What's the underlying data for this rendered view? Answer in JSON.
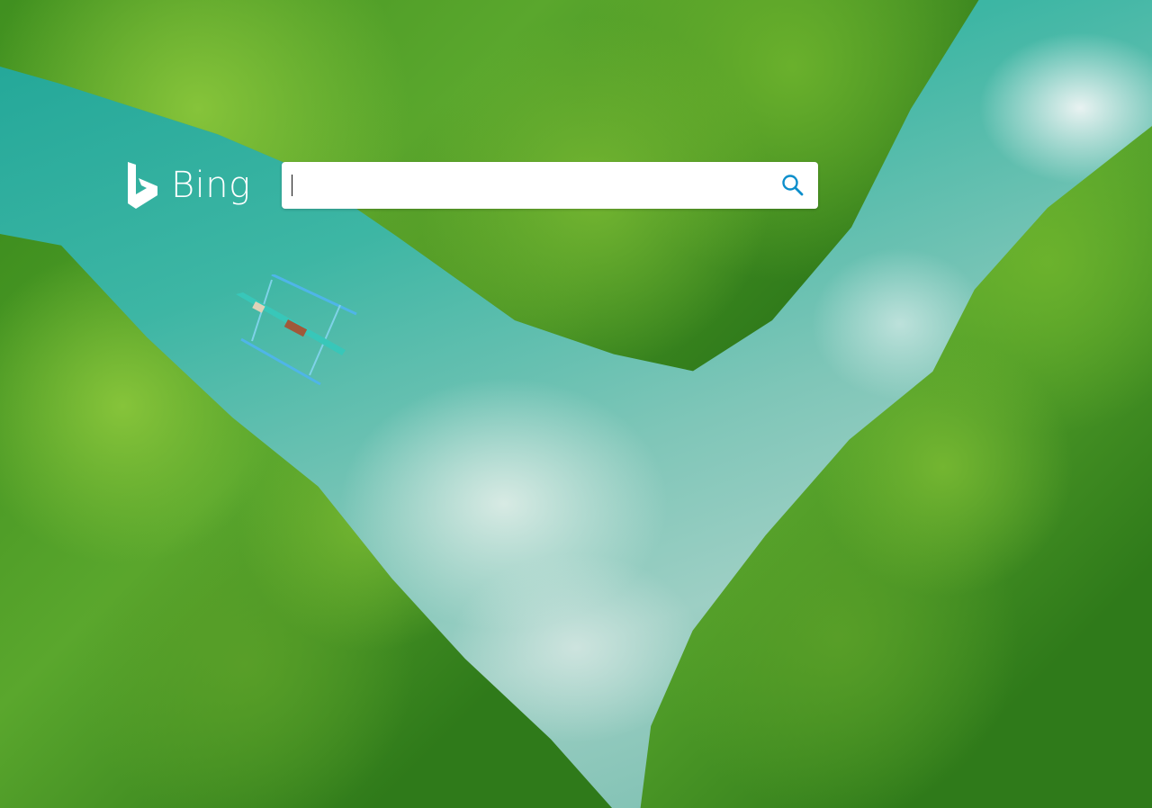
{
  "brand": {
    "name": "Bing",
    "logo_color": "#ffffff"
  },
  "search": {
    "value": "",
    "placeholder": "",
    "button_icon": "search-icon",
    "accent_color": "#0c8ecb"
  }
}
